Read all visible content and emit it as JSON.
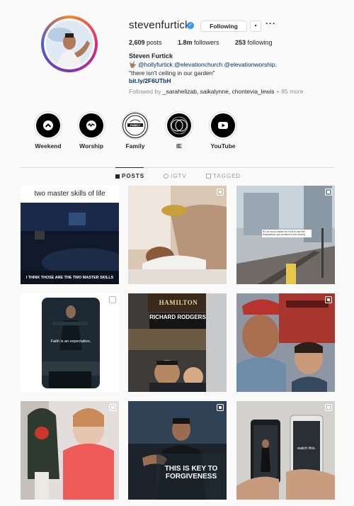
{
  "profile": {
    "username": "stevenfurtick",
    "verified_glyph": "✓",
    "follow_label": "Following",
    "dropdown_glyph": "▾",
    "more_glyph": "···",
    "stats": {
      "posts_count": "2,609",
      "posts_label": "posts",
      "followers_count": "1.8m",
      "followers_label": "followers",
      "following_count": "253",
      "following_label": "following"
    },
    "full_name": "Steven Furtick",
    "bio_emoji": "🤟🏽",
    "bio_mentions": "@hollyfurtick @elevationchurch @elevationworship.",
    "bio_quote": "\"there isn't ceiling in our garden\"",
    "bio_link": "bit.ly/2F6UTbH",
    "followed_by_prefix": "Followed by",
    "followed_by_names": "_sarahelizab, saikalynne, chontevia_lewis",
    "followed_by_more": "+ 85 more"
  },
  "highlights": [
    {
      "label": "Weekend",
      "icon": "chevron-up-icon",
      "glyph": "⌃"
    },
    {
      "label": "Worship",
      "icon": "wave-icon",
      "glyph": "∿"
    },
    {
      "label": "Family",
      "icon": "family-logo-icon",
      "glyph": "FAMILY"
    },
    {
      "label": "IE",
      "icon": "circles-icon",
      "glyph": ""
    },
    {
      "label": "YouTube",
      "icon": "youtube-icon",
      "glyph": "▶"
    }
  ],
  "tabs": [
    {
      "label": "POSTS",
      "icon": "grid-icon",
      "active": true
    },
    {
      "label": "IGTV",
      "icon": "igtv-icon",
      "active": false
    },
    {
      "label": "TAGGED",
      "icon": "tag-icon",
      "active": false
    }
  ],
  "posts": [
    {
      "caption_top": "two master skills of life",
      "caption_bottom": "I THINK THOSE ARE THE TWO MASTER SKILLS",
      "type": "video"
    },
    {
      "type": "video"
    },
    {
      "small_text": "It's so much easier for God to use the temptations you present to the enemy",
      "type": "video"
    },
    {
      "caption": "Faith is an expectation.",
      "type": "video"
    },
    {
      "sign_top": "HAMILTON",
      "sign_bottom": "RICHARD RODGERS",
      "type": "photo"
    },
    {
      "type": "carousel"
    },
    {
      "type": "video"
    },
    {
      "caption": "THIS IS KEY TO FORGIVENESS",
      "type": "video"
    },
    {
      "caption": "watch this.",
      "type": "video"
    }
  ],
  "colors": {
    "link": "#003569",
    "verified": "#3897f0",
    "muted": "#8e8e8e",
    "border": "#dbdbdb"
  }
}
